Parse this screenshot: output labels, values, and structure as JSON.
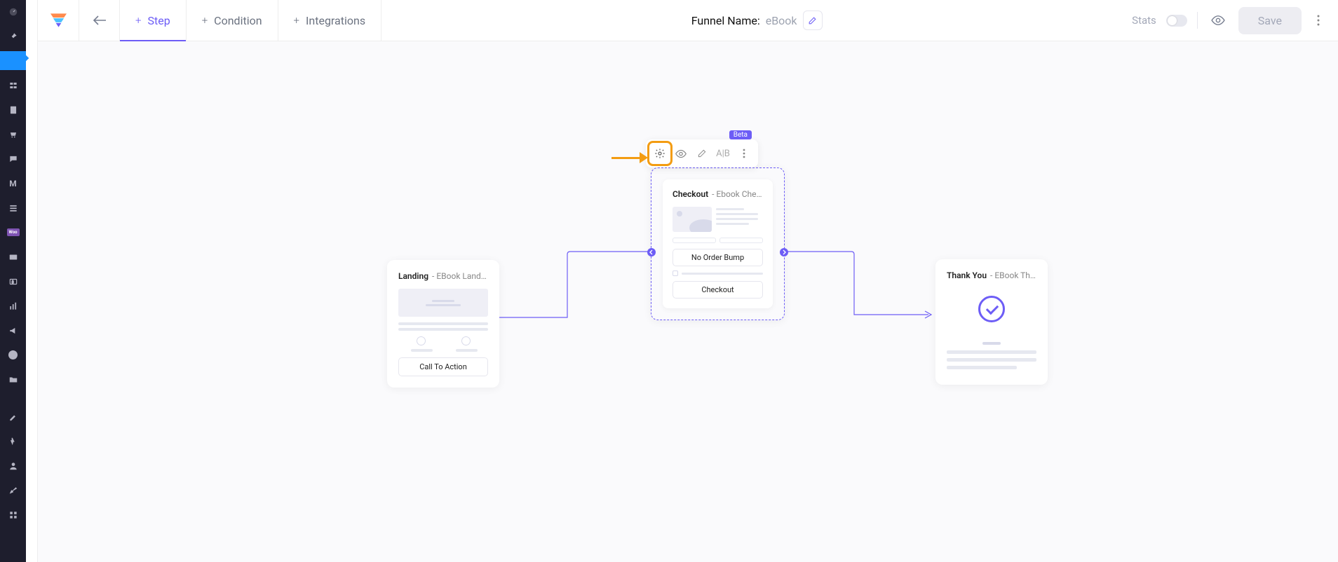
{
  "header": {
    "tabs": {
      "step": "Step",
      "condition": "Condition",
      "integrations": "Integrations"
    },
    "funnel_name_label": "Funnel Name:",
    "funnel_name_value": "eBook",
    "stats_label": "Stats",
    "save_label": "Save"
  },
  "node_toolbar": {
    "ab_label": "A|B",
    "badge": "Beta"
  },
  "nodes": {
    "landing": {
      "type": "Landing",
      "sep": " - ",
      "name": "EBook Landing",
      "cta": "Call To Action"
    },
    "checkout": {
      "type": "Checkout",
      "sep": " - ",
      "name": "Ebook Checkout",
      "no_bump": "No Order Bump",
      "btn": "Checkout"
    },
    "thankyou": {
      "type": "Thank You",
      "sep": " - ",
      "name": "EBook Thank Y…"
    }
  }
}
